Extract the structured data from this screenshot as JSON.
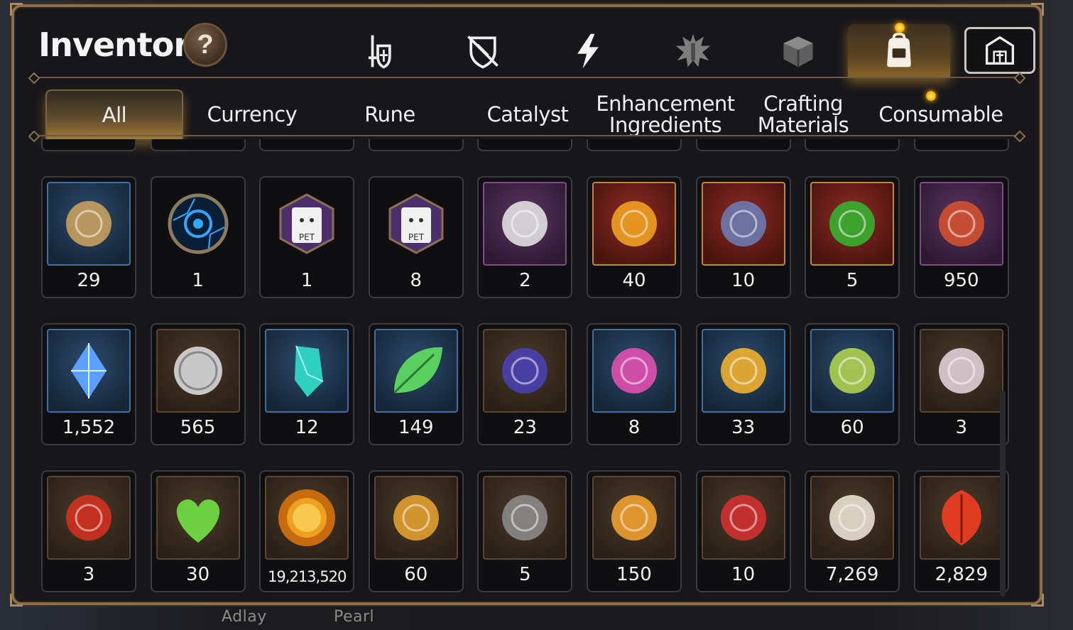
{
  "window": {
    "title": "Inventory",
    "help_label": "?"
  },
  "top_tabs": [
    {
      "name": "equipment-tab",
      "icon": "sword-shield-icon"
    },
    {
      "name": "artifact-tab",
      "icon": "broken-shield-icon"
    },
    {
      "name": "skill-tab",
      "icon": "lightning-icon"
    },
    {
      "name": "emblem-tab",
      "icon": "spiky-emblem-icon"
    },
    {
      "name": "materials-tab",
      "icon": "cube-icon"
    },
    {
      "name": "bag-tab",
      "icon": "backpack-icon",
      "active": true
    },
    {
      "name": "guild-tab",
      "icon": "castle-icon"
    }
  ],
  "category_tabs": [
    {
      "label": "All",
      "active": true
    },
    {
      "label": "Currency"
    },
    {
      "label": "Rune"
    },
    {
      "label": "Catalyst"
    },
    {
      "label": "Enhancement\nIngredients"
    },
    {
      "label": "Crafting\nMaterials"
    },
    {
      "label": "Consumable"
    }
  ],
  "items": [
    {
      "count": "29",
      "frame": "blue",
      "icon": "ginseng-root-icon",
      "color": "#c9a060"
    },
    {
      "count": "1",
      "frame": "none",
      "icon": "blue-rune-orb-icon",
      "color": "#2fa8ff"
    },
    {
      "count": "1",
      "frame": "none",
      "icon": "pet-food-bag-icon",
      "color": "#f0f0f0"
    },
    {
      "count": "8",
      "frame": "none",
      "icon": "pet-food-bag-icon",
      "color": "#f0f0f0"
    },
    {
      "count": "2",
      "frame": "purple",
      "icon": "feather-wand-icon",
      "color": "#e0e0e0"
    },
    {
      "count": "40",
      "frame": "red",
      "icon": "amber-crystal-icon",
      "color": "#f0a020"
    },
    {
      "count": "10",
      "frame": "red",
      "icon": "necklace-icon",
      "color": "#6a7ab0"
    },
    {
      "count": "5",
      "frame": "red",
      "icon": "clover-pendant-icon",
      "color": "#36b030"
    },
    {
      "count": "950",
      "frame": "purple",
      "icon": "bracelet-icon",
      "color": "#d05030"
    },
    {
      "count": "1,552",
      "frame": "blue",
      "icon": "blue-gem-icon",
      "color": "#5aa0ff"
    },
    {
      "count": "565",
      "frame": "brown",
      "icon": "silver-coin-icon",
      "color": "#c8c8c8"
    },
    {
      "count": "12",
      "frame": "blue",
      "icon": "teal-crystal-icon",
      "color": "#30d0c0"
    },
    {
      "count": "149",
      "frame": "blue",
      "icon": "green-leaf-icon",
      "color": "#5ad060"
    },
    {
      "count": "23",
      "frame": "brown",
      "icon": "pet-card-icon",
      "color": "#4a40b0"
    },
    {
      "count": "8",
      "frame": "blue",
      "icon": "pink-crystal-pile-icon",
      "color": "#e050b0"
    },
    {
      "count": "33",
      "frame": "blue",
      "icon": "star-amulet-icon",
      "color": "#f0b030"
    },
    {
      "count": "60",
      "frame": "blue",
      "icon": "costume-card-icon",
      "color": "#b0d050"
    },
    {
      "count": "3",
      "frame": "brown",
      "icon": "pod-device-icon",
      "color": "#e0d0d8"
    },
    {
      "count": "3",
      "frame": "brown",
      "icon": "red-seal-badge-icon",
      "color": "#d03020"
    },
    {
      "count": "30",
      "frame": "brown",
      "icon": "green-heart-icon",
      "color": "#6cd040"
    },
    {
      "count": "19,213,520",
      "frame": "brown",
      "icon": "gold-sun-coin-icon",
      "color": "#f0a020"
    },
    {
      "count": "60",
      "frame": "brown",
      "icon": "gold-hex-emblem-icon",
      "color": "#e0a030"
    },
    {
      "count": "5",
      "frame": "brown",
      "icon": "compass-stone-icon",
      "color": "#8a8a8a"
    },
    {
      "count": "150",
      "frame": "brown",
      "icon": "fist-badge-icon",
      "color": "#f0a030"
    },
    {
      "count": "10",
      "frame": "brown",
      "icon": "red-banner-icon",
      "color": "#d03030"
    },
    {
      "count": "7,269",
      "frame": "brown",
      "icon": "knight-chess-piece-icon",
      "color": "#e8e0d0"
    },
    {
      "count": "2,829",
      "frame": "brown",
      "icon": "red-leaf-icon",
      "color": "#e03a20"
    }
  ],
  "background": {
    "left_text": "Adlay",
    "right_text": "Pearl"
  }
}
